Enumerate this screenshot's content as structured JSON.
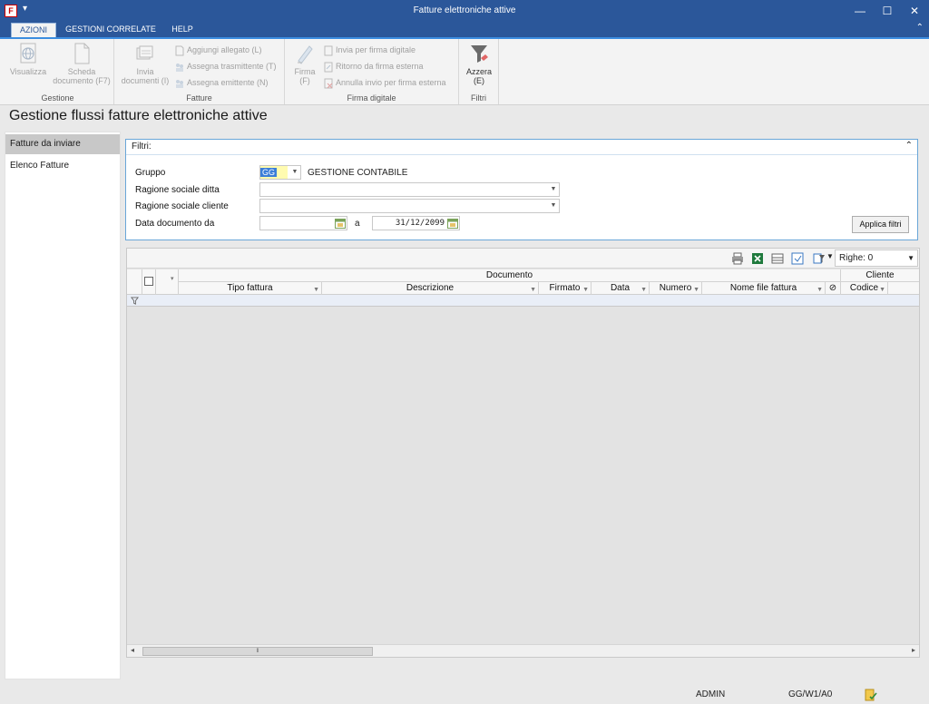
{
  "window": {
    "title": "Fatture elettroniche attive",
    "app_icon_text": "F",
    "minimize": "—",
    "maximize": "☐",
    "close": "✕"
  },
  "tabs": [
    {
      "label": "AZIONI",
      "active": true
    },
    {
      "label": "GESTIONI CORRELATE",
      "active": false
    },
    {
      "label": "HELP",
      "active": false
    }
  ],
  "ribbon": {
    "groups": {
      "gestione": "Gestione",
      "fatture": "Fatture",
      "firma": "Firma digitale",
      "filtri": "Filtri"
    },
    "visualizza": "Visualizza",
    "scheda_1": "Scheda",
    "scheda_2": "documento (F7)",
    "invia_1": "Invia",
    "invia_2": "documenti (I)",
    "aggiungi_allegato": "Aggiungi allegato (L)",
    "assegna_trasmittente": "Assegna trasmittente (T)",
    "assegna_emittente": "Assegna emittente (N)",
    "firma_1": "Firma",
    "firma_2": "(F)",
    "invia_firma": "Invia per firma digitale",
    "ritorno_firma": "Ritorno da firma esterna",
    "annulla_invio": "Annulla invio per firma esterna",
    "azzera_1": "Azzera",
    "azzera_2": "(E)"
  },
  "page_title": "Gestione flussi fatture elettroniche attive",
  "sidebar": {
    "items": [
      {
        "label": "Fatture da inviare",
        "active": true
      },
      {
        "label": "Elenco Fatture",
        "active": false
      }
    ]
  },
  "filters": {
    "title": "Filtri:",
    "gruppo_label": "Gruppo",
    "gruppo_code": "GG",
    "gruppo_desc": "GESTIONE CONTABILE",
    "ditta_label": "Ragione sociale ditta",
    "ditta_value": "",
    "cliente_label": "Ragione sociale cliente",
    "cliente_value": "",
    "data_label": "Data documento da",
    "data_da": "",
    "a_label": "a",
    "data_a": "31/12/2099",
    "apply_button": "Applica filtri"
  },
  "grid": {
    "righe_label": "Righe: 0",
    "group_documento": "Documento",
    "group_cliente": "Cliente",
    "columns": {
      "tipo_fattura": "Tipo fattura",
      "descrizione": "Descrizione",
      "firmato": "Firmato",
      "data": "Data",
      "numero": "Numero",
      "nome_file": "Nome file fattura",
      "codice": "Codice"
    },
    "rows": []
  },
  "status": {
    "user": "ADMIN",
    "context": "GG/W1/A0"
  },
  "colors": {
    "titlebar": "#2b579a",
    "accent": "#3b8de0"
  }
}
